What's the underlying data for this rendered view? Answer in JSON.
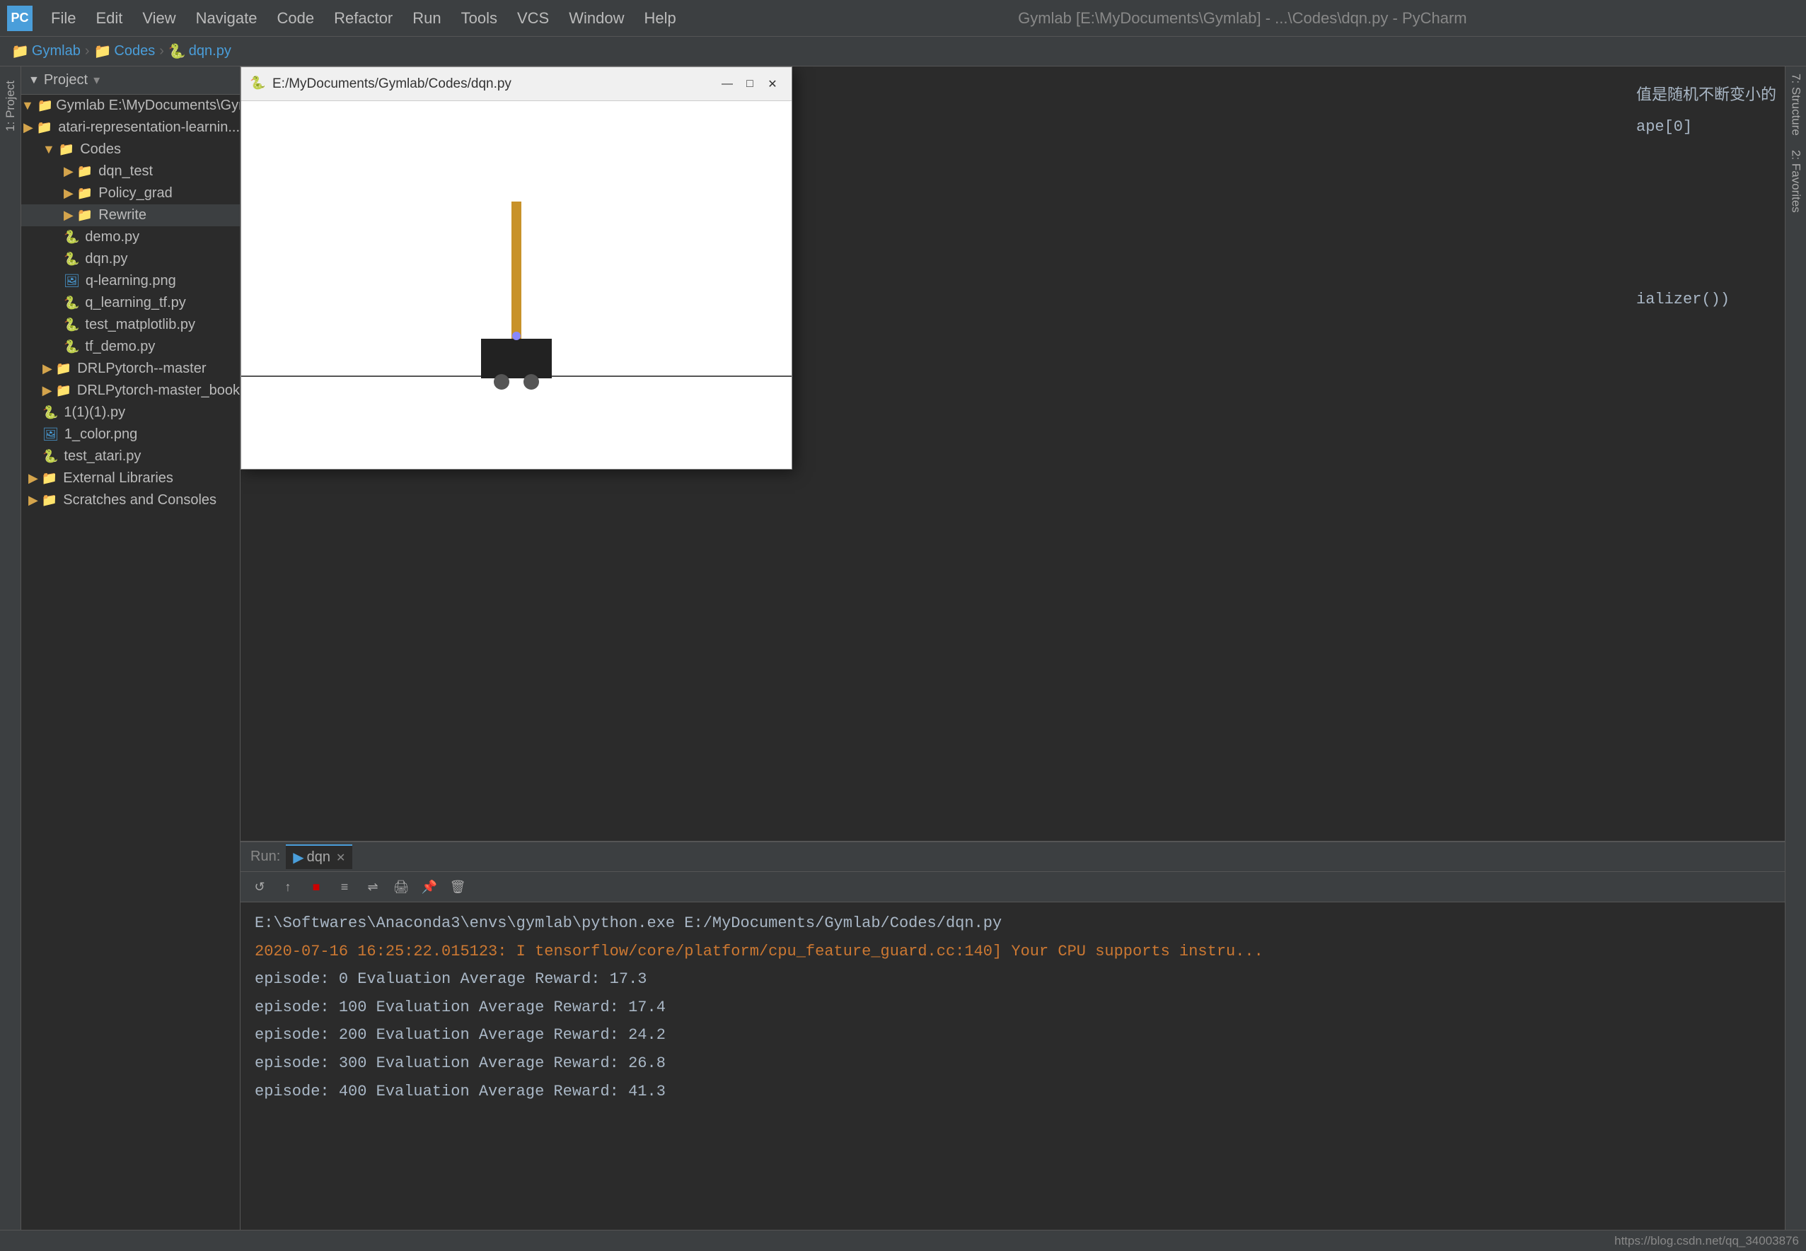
{
  "app": {
    "title": "Gymlab [E:\\MyDocuments\\Gymlab] - ...\\Codes\\dqn.py - PyCharm",
    "logo": "PC"
  },
  "menubar": {
    "items": [
      "File",
      "Edit",
      "View",
      "Navigate",
      "Code",
      "Refactor",
      "Run",
      "Tools",
      "VCS",
      "Window",
      "Help"
    ]
  },
  "breadcrumb": {
    "items": [
      "Gymlab",
      "Codes",
      "dqn.py"
    ]
  },
  "sidebar": {
    "tab_label": "1: Project"
  },
  "project_panel": {
    "header": "Project",
    "tree": [
      {
        "label": "Gymlab  E:\\MyDocuments\\Gym",
        "type": "folder",
        "level": 0,
        "expanded": true
      },
      {
        "label": "atari-representation-learnin...",
        "type": "folder",
        "level": 1,
        "expanded": false
      },
      {
        "label": "Codes",
        "type": "folder",
        "level": 1,
        "expanded": true
      },
      {
        "label": "dqn_test",
        "type": "folder",
        "level": 2,
        "expanded": false
      },
      {
        "label": "Policy_grad",
        "type": "folder",
        "level": 2,
        "expanded": false
      },
      {
        "label": "Rewrite",
        "type": "folder",
        "level": 2,
        "expanded": false
      },
      {
        "label": "demo.py",
        "type": "py",
        "level": 2
      },
      {
        "label": "dqn.py",
        "type": "py",
        "level": 2
      },
      {
        "label": "q-learning.png",
        "type": "img",
        "level": 2
      },
      {
        "label": "q_learning_tf.py",
        "type": "py",
        "level": 2
      },
      {
        "label": "test_matplotlib.py",
        "type": "py",
        "level": 2
      },
      {
        "label": "tf_demo.py",
        "type": "py",
        "level": 2
      },
      {
        "label": "DRLPytorch--master",
        "type": "folder",
        "level": 1,
        "expanded": false
      },
      {
        "label": "DRLPytorch-master_book",
        "type": "folder",
        "level": 1,
        "expanded": false
      },
      {
        "label": "1(1)(1).py",
        "type": "py",
        "level": 1
      },
      {
        "label": "1_color.png",
        "type": "img",
        "level": 1
      },
      {
        "label": "test_atari.py",
        "type": "py",
        "level": 1
      },
      {
        "label": "External Libraries",
        "type": "folder",
        "level": 0,
        "expanded": false
      },
      {
        "label": "Scratches and Consoles",
        "type": "folder",
        "level": 0,
        "expanded": false
      }
    ]
  },
  "floating_window": {
    "title": "E:/MyDocuments/Gymlab/Codes/dqn.py",
    "logo": "🐍",
    "buttons": {
      "minimize": "—",
      "maximize": "□",
      "close": "✕"
    }
  },
  "code_right": {
    "line1": "值是随机不断变小的",
    "line2": "ape[0]",
    "line3": "ializer())"
  },
  "run_panel": {
    "header": "Run:",
    "tab_name": "dqn",
    "command": "E:\\Softwares\\Anaconda3\\envs\\gymlab\\python.exe E:/MyDocuments/Gymlab/Codes/dqn.py",
    "warning": "2020-07-16 16:25:22.015123: I tensorflow/core/platform/cpu_feature_guard.cc:140] Your CPU supports instru...",
    "lines": [
      "episode:   0 Evaluation Average Reward: 17.3",
      "episode: 100 Evaluation Average Reward: 17.4",
      "episode: 200 Evaluation Average Reward: 24.2",
      "episode: 300 Evaluation Average Reward: 26.8",
      "episode: 400 Evaluation Average Reward: 41.3"
    ]
  },
  "statusbar": {
    "right_text": "https://blog.csdn.net/qq_34003876"
  },
  "right_sidebar": {
    "tab1": "7: Structure",
    "tab2": "2: Favorites"
  }
}
